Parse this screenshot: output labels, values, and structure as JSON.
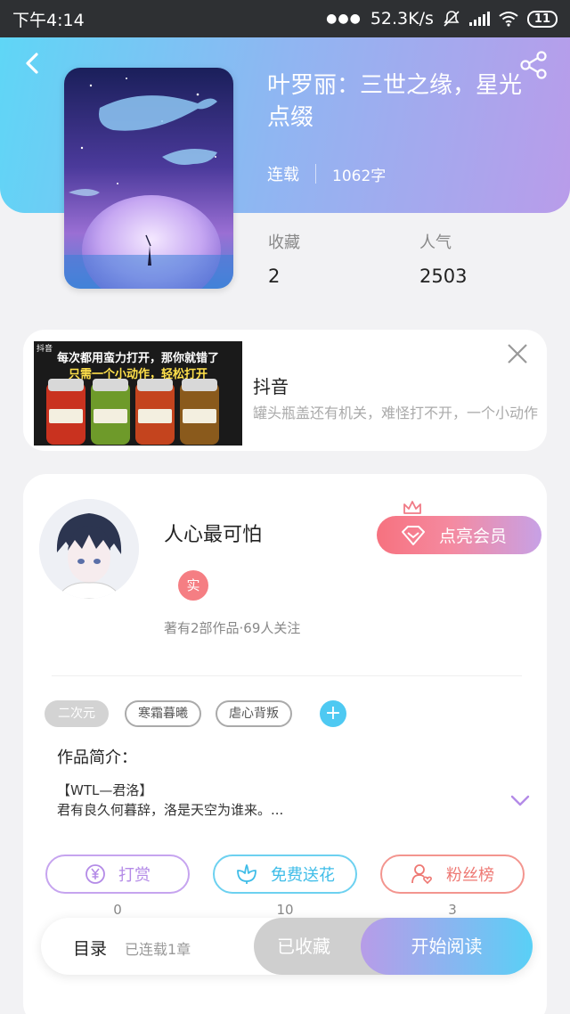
{
  "status_bar": {
    "time": "下午4:14",
    "network_speed": "52.3K/s",
    "battery": "11"
  },
  "book": {
    "title": "叶罗丽：三世之缘，星光点缀",
    "status": "连载",
    "word_count": "1062字",
    "stats": [
      {
        "label": "收藏",
        "value": "2"
      },
      {
        "label": "人气",
        "value": "2503"
      }
    ]
  },
  "ad": {
    "image_text_1": "每次都用蛮力打开，那你就错了",
    "image_text_2": "只需一个小动作，轻松打开",
    "source_label": "抖音",
    "name": "抖音",
    "description": "罐头瓶盖还有机关，难怪打不开，一个小动作"
  },
  "author": {
    "name": "人心最可怕",
    "badge": "实",
    "meta": "著有2部作品·69人关注",
    "vip_button": "点亮会员"
  },
  "tags": [
    "二次元",
    "寒霜暮曦",
    "虐心背叛"
  ],
  "intro": {
    "label": "作品简介：",
    "line1": "【WTL—君洛】",
    "line2": "君有良久何暮辞，洛是天空为谁来。..."
  },
  "actions": [
    {
      "label": "打赏",
      "count": "0"
    },
    {
      "label": "免费送花",
      "count": "10"
    },
    {
      "label": "粉丝榜",
      "count": "3"
    }
  ],
  "bottom_bar": {
    "toc_label": "目录",
    "toc_meta": "已连载1章",
    "collected_label": "已收藏",
    "read_label": "开始阅读"
  },
  "colors": {
    "header_gradient_start": "#5fd6f6",
    "header_gradient_end": "#b99cea",
    "vip_gradient_start": "#f6727f",
    "real_badge": "#f57e83",
    "tag_add": "#4ec9f2",
    "reward": "#b48be7",
    "flower": "#3fbde8",
    "fans": "#ee7873"
  }
}
